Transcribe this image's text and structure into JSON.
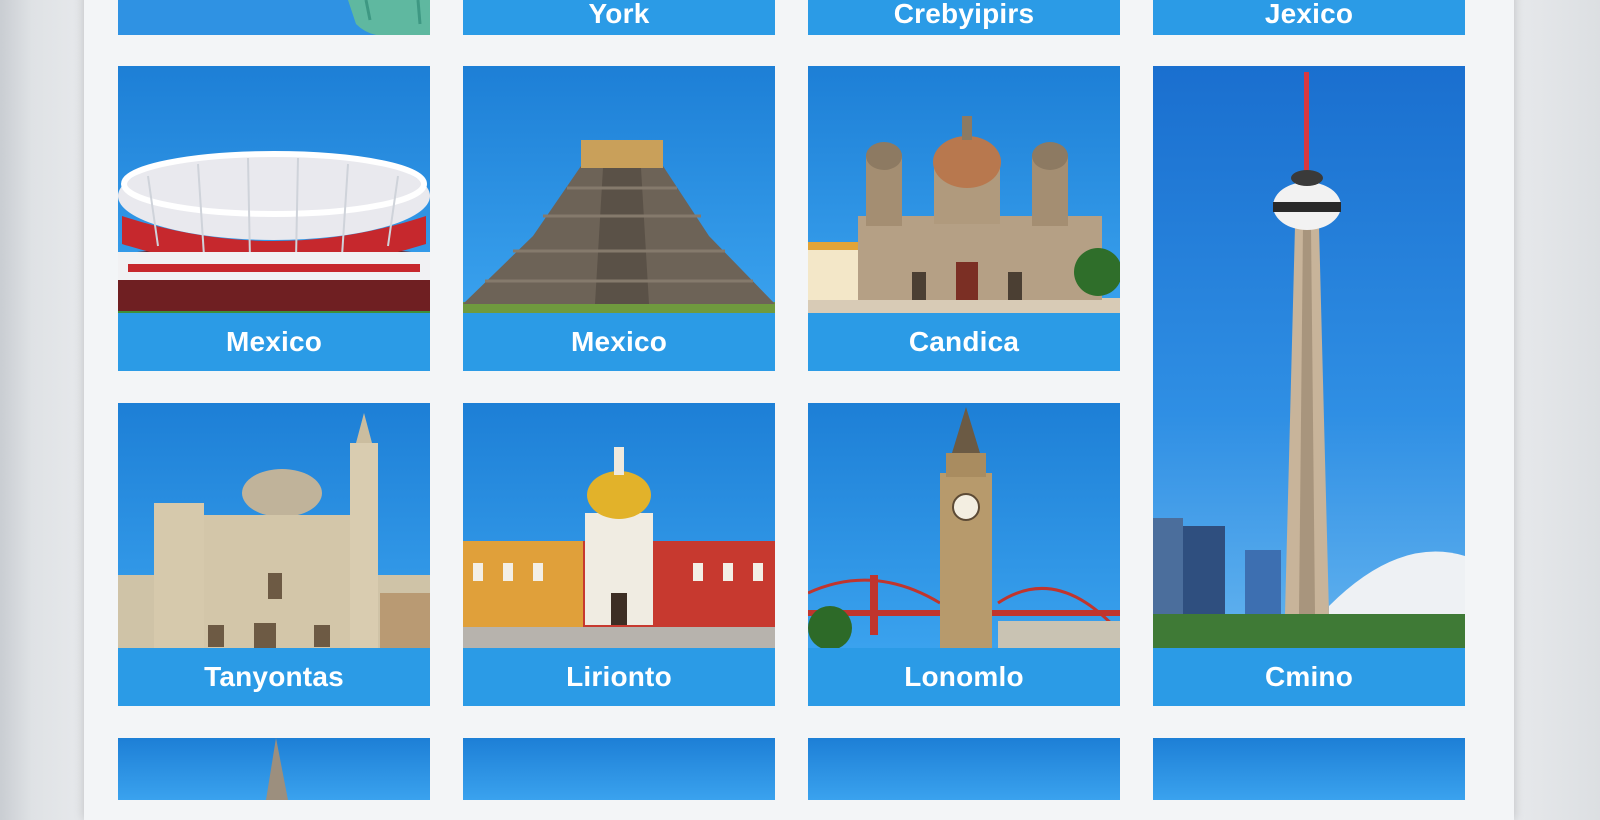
{
  "tiles_top": [
    {
      "label": "",
      "icon": "statue-of-liberty-icon"
    },
    {
      "label": "York"
    },
    {
      "label": "Crebyipirs"
    },
    {
      "label": "Jexico"
    }
  ],
  "tiles_row1": [
    {
      "label": "Mexico",
      "icon": "stadium-icon"
    },
    {
      "label": "Mexico",
      "icon": "pyramid-icon"
    },
    {
      "label": "Candica",
      "icon": "cathedral-icon"
    }
  ],
  "tiles_row2": [
    {
      "label": "Tanyontas",
      "icon": "church-icon"
    },
    {
      "label": "Lirionto",
      "icon": "palace-icon"
    },
    {
      "label": "Lonomlo",
      "icon": "clock-tower-icon"
    }
  ],
  "tall_tile": {
    "label": "Cmino",
    "icon": "cn-tower-icon"
  },
  "colors": {
    "accent": "#2b9be6",
    "sky": "#2f92e3",
    "panel": "#f3f5f7"
  }
}
